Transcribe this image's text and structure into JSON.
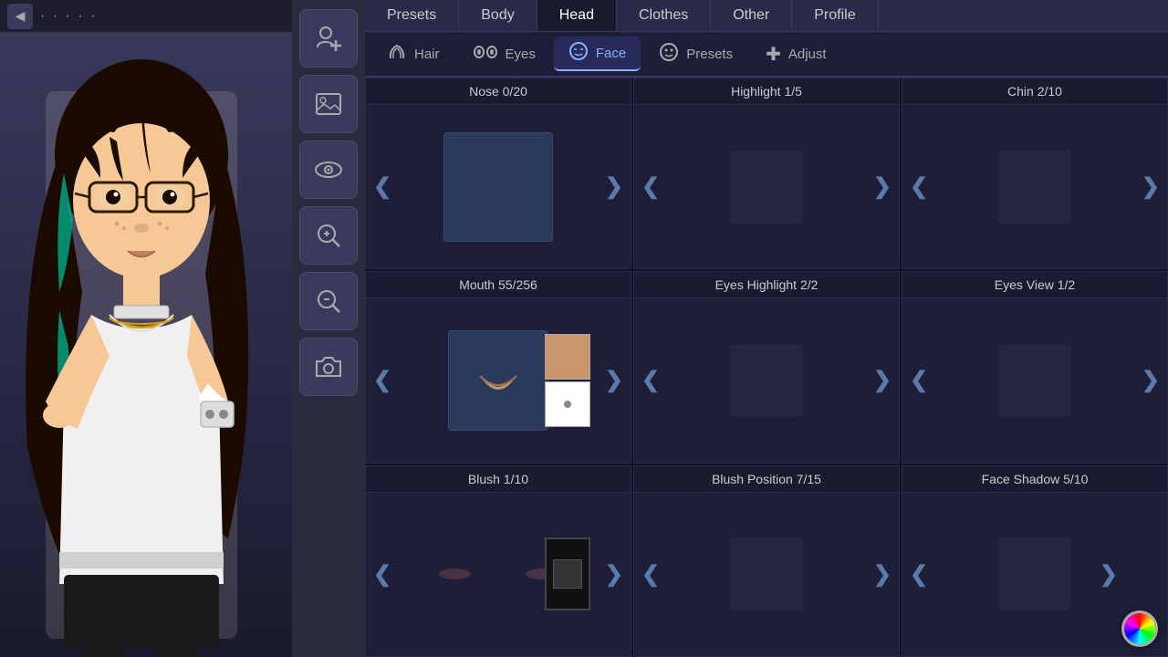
{
  "topNav": {
    "items": [
      {
        "id": "presets",
        "label": "Presets",
        "active": false
      },
      {
        "id": "body",
        "label": "Body",
        "active": false
      },
      {
        "id": "head",
        "label": "Head",
        "active": true
      },
      {
        "id": "clothes",
        "label": "Clothes",
        "active": false
      },
      {
        "id": "other",
        "label": "Other",
        "active": false
      },
      {
        "id": "profile",
        "label": "Profile",
        "active": false
      }
    ]
  },
  "subNav": {
    "items": [
      {
        "id": "hair",
        "label": "Hair",
        "icon": "🦱",
        "active": false
      },
      {
        "id": "eyes",
        "label": "Eyes",
        "icon": "👁",
        "active": false
      },
      {
        "id": "face",
        "label": "Face",
        "icon": "😐",
        "active": true
      },
      {
        "id": "presets",
        "label": "Presets",
        "icon": "😊",
        "active": false
      },
      {
        "id": "adjust",
        "label": "Adjust",
        "icon": "➕",
        "active": false
      }
    ]
  },
  "grid": {
    "cells": [
      {
        "id": "nose",
        "header": "Nose 0/20",
        "type": "nose",
        "col": 1
      },
      {
        "id": "highlight",
        "header": "Highlight 1/5",
        "type": "empty",
        "col": 2
      },
      {
        "id": "chin",
        "header": "Chin 2/10",
        "type": "empty",
        "col": 3
      },
      {
        "id": "mouth",
        "header": "Mouth 55/256",
        "type": "mouth",
        "col": 1
      },
      {
        "id": "eyes-highlight",
        "header": "Eyes Highlight 2/2",
        "type": "empty",
        "col": 2
      },
      {
        "id": "eyes-view",
        "header": "Eyes View 1/2",
        "type": "empty",
        "col": 3
      },
      {
        "id": "blush",
        "header": "Blush 1/10",
        "type": "blush",
        "col": 1
      },
      {
        "id": "blush-position",
        "header": "Blush Position 7/15",
        "type": "empty",
        "col": 2
      },
      {
        "id": "face-shadow",
        "header": "Face Shadow 5/10",
        "type": "empty",
        "col": 3
      }
    ]
  },
  "toolbar": {
    "buttons": [
      {
        "id": "add-character",
        "icon": "👤+",
        "label": "Add Character"
      },
      {
        "id": "gallery",
        "icon": "🖼",
        "label": "Gallery"
      },
      {
        "id": "visibility",
        "icon": "👁",
        "label": "Visibility"
      },
      {
        "id": "zoom-in",
        "icon": "🔍+",
        "label": "Zoom In"
      },
      {
        "id": "zoom-out",
        "icon": "🔍-",
        "label": "Zoom Out"
      },
      {
        "id": "camera",
        "icon": "📷",
        "label": "Camera"
      }
    ]
  },
  "topLeftUI": {
    "backLabel": "◀",
    "dotsIndicator": "· · · · ·"
  }
}
